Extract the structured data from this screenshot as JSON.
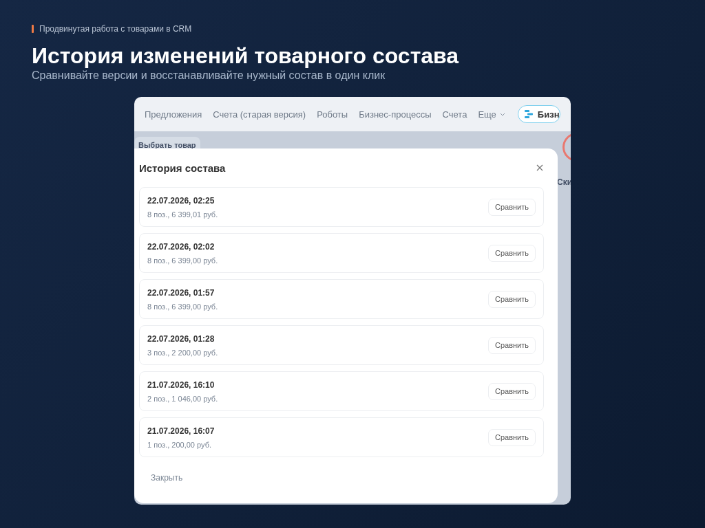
{
  "slide": {
    "kicker": "Продвинутая работа с товарами в CRM",
    "title": "История изменений товарного состава",
    "subtitle": "Сравнивайте версии и восстанавливайте нужный состав в один клик"
  },
  "app": {
    "nav": [
      {
        "label": "Предложения",
        "kind": "link"
      },
      {
        "label": "Счета (старая версия)",
        "kind": "link"
      },
      {
        "label": "Роботы",
        "kind": "link"
      },
      {
        "label": "Бизнес-процессы",
        "kind": "link"
      },
      {
        "label": "Счета",
        "kind": "link"
      },
      {
        "label": "Еще",
        "kind": "menu"
      },
      {
        "label": "Бизн",
        "kind": "button"
      }
    ],
    "product_tab": "Выбрать товар",
    "column_heading": "Ски",
    "modal": {
      "title": "История состава",
      "versions": [
        {
          "date": "22.07.2026, 02:25",
          "summary": "8 поз., 6 399,01 руб.",
          "action": "Сравнить"
        },
        {
          "date": "22.07.2026, 02:02",
          "summary": "8 поз., 6 399,00 руб.",
          "action": "Сравнить"
        },
        {
          "date": "22.07.2026, 01:57",
          "summary": "8 поз., 6 399,00 руб.",
          "action": "Сравнить"
        },
        {
          "date": "22.07.2026, 01:28",
          "summary": "3 поз., 2 200,00 руб.",
          "action": "Сравнить"
        },
        {
          "date": "21.07.2026, 16:10",
          "summary": "2 поз., 1 046,00 руб.",
          "action": "Сравнить"
        },
        {
          "date": "21.07.2026, 16:07",
          "summary": "1 поз., 200,00 руб.",
          "action": "Сравнить"
        }
      ],
      "close_label": "Закрыть"
    }
  }
}
